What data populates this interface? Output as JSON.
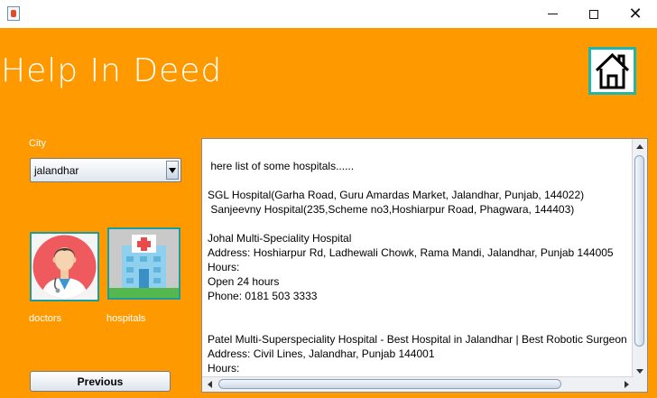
{
  "window": {
    "icon": "java-app-icon",
    "minimize_icon": "minimize-icon",
    "maximize_icon": "maximize-icon",
    "close_glyph": "✕"
  },
  "app": {
    "title": "Help In Deed",
    "home_icon": "home-icon"
  },
  "city": {
    "label": "City",
    "selected": "jalandhar"
  },
  "tiles": {
    "doctors_label": "doctors",
    "hospitals_label": "hospitals"
  },
  "buttons": {
    "previous_label": "Previous"
  },
  "info": {
    "text": " here list of some hospitals......\n\nSGL Hospital(Garha Road, Guru Amardas Market, Jalandhar, Punjab, 144022)\n Sanjeevny Hospital(235,Scheme no3,Hoshiarpur Road, Phagwara, 144403)\n\nJohal Multi-Speciality Hospital\nAddress: Hoshiarpur Rd, Ladhewali Chowk, Rama Mandi, Jalandhar, Punjab 144005\nHours:\nOpen 24 hours\nPhone: 0181 503 3333\n\n\nPatel Multi-Superspeciality Hospital - Best Hospital in Jalandhar | Best Robotic Surgeon\nAddress: Civil Lines, Jalandhar, Punjab 144001\nHours:"
  },
  "colors": {
    "background": "#ff9900",
    "tile_border": "#1e9c9c",
    "title_text": "#ffffff"
  }
}
